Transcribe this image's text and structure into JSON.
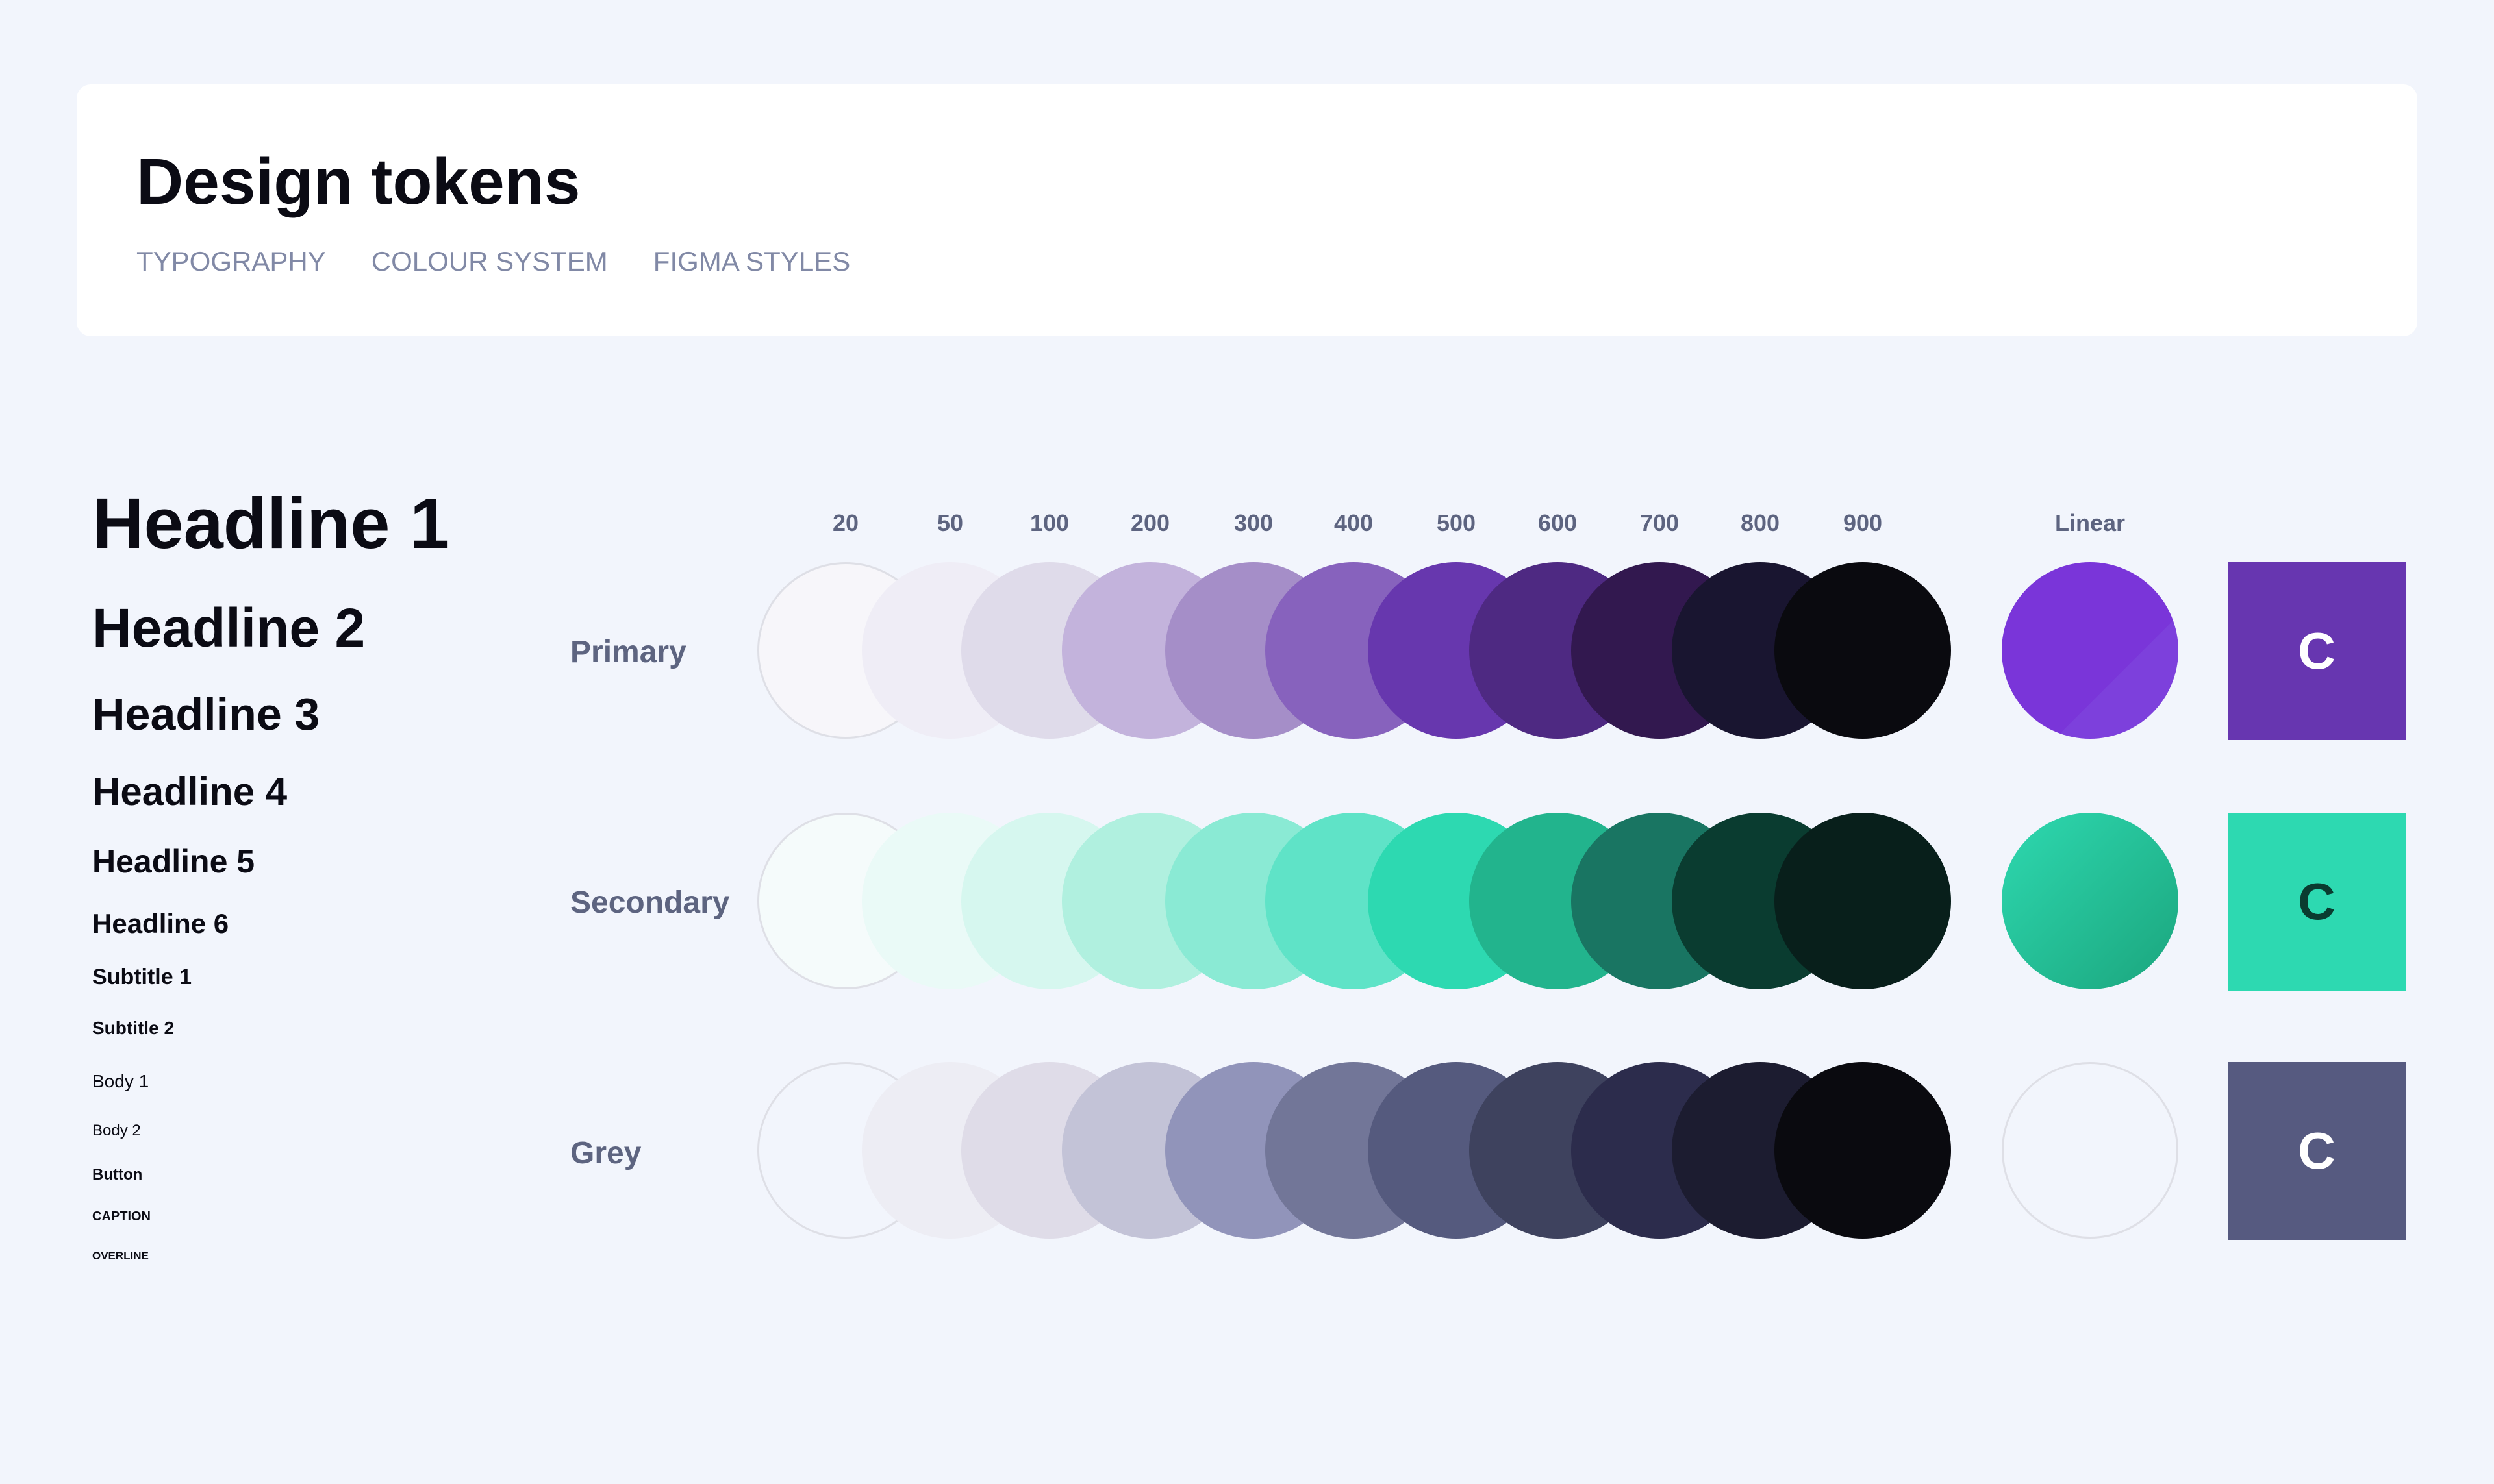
{
  "header": {
    "title": "Design tokens",
    "nav": [
      "TYPOGRAPHY",
      "COLOUR SYSTEM",
      "FIGMA STYLES"
    ]
  },
  "typography": [
    "Headline 1",
    "Headline 2",
    "Headline 3",
    "Headline 4",
    "Headline 5",
    "Headline 6",
    "Subtitle 1",
    "Subtitle 2",
    "Body 1",
    "Body 2",
    "Button",
    "CAPTION",
    "OVERLINE"
  ],
  "palette": {
    "scale": [
      "20",
      "50",
      "100",
      "200",
      "300",
      "400",
      "500",
      "600",
      "700",
      "800",
      "900"
    ],
    "linear_label": "Linear",
    "rows": [
      {
        "name": "Primary",
        "colors": [
          "#f7f6fa",
          "#efedf6",
          "#dfdbea",
          "#c3b3dc",
          "#a58ec8",
          "#8762bd",
          "#6737ae",
          "#4e2982",
          "#32184f",
          "#191530",
          "#0a0a0f"
        ],
        "linear": [
          "#7a35d9",
          "#7d40dc"
        ],
        "tile_color": "#6736b0",
        "tile_text_color": "#ffffff",
        "tile_letter": "C"
      },
      {
        "name": "Secondary",
        "colors": [
          "#f5fbfb",
          "#eafaf7",
          "#d6f7ef",
          "#b0f0df",
          "#8aead4",
          "#5fe3c7",
          "#2dd9b1",
          "#22b48d",
          "#197562",
          "#0a3c30",
          "#081f1b"
        ],
        "linear": [
          "#2ed9b0",
          "#1ba57d"
        ],
        "tile_color": "#2dd9b1",
        "tile_text_color": "#0a3c30",
        "tile_letter": "C"
      },
      {
        "name": "Grey",
        "colors": [
          "#f2f5fc",
          "#ededf4",
          "#dfdce8",
          "#c3c3d7",
          "#9194ba",
          "#727698",
          "#555a7e",
          "#3e425e",
          "#2c2c4c",
          "#1c1c30",
          "#0a0a0f"
        ],
        "linear": [
          "#f2f5fc",
          "#f2f5fc"
        ],
        "tile_color": "#565a80",
        "tile_text_color": "#ffffff",
        "tile_letter": "C"
      }
    ]
  }
}
